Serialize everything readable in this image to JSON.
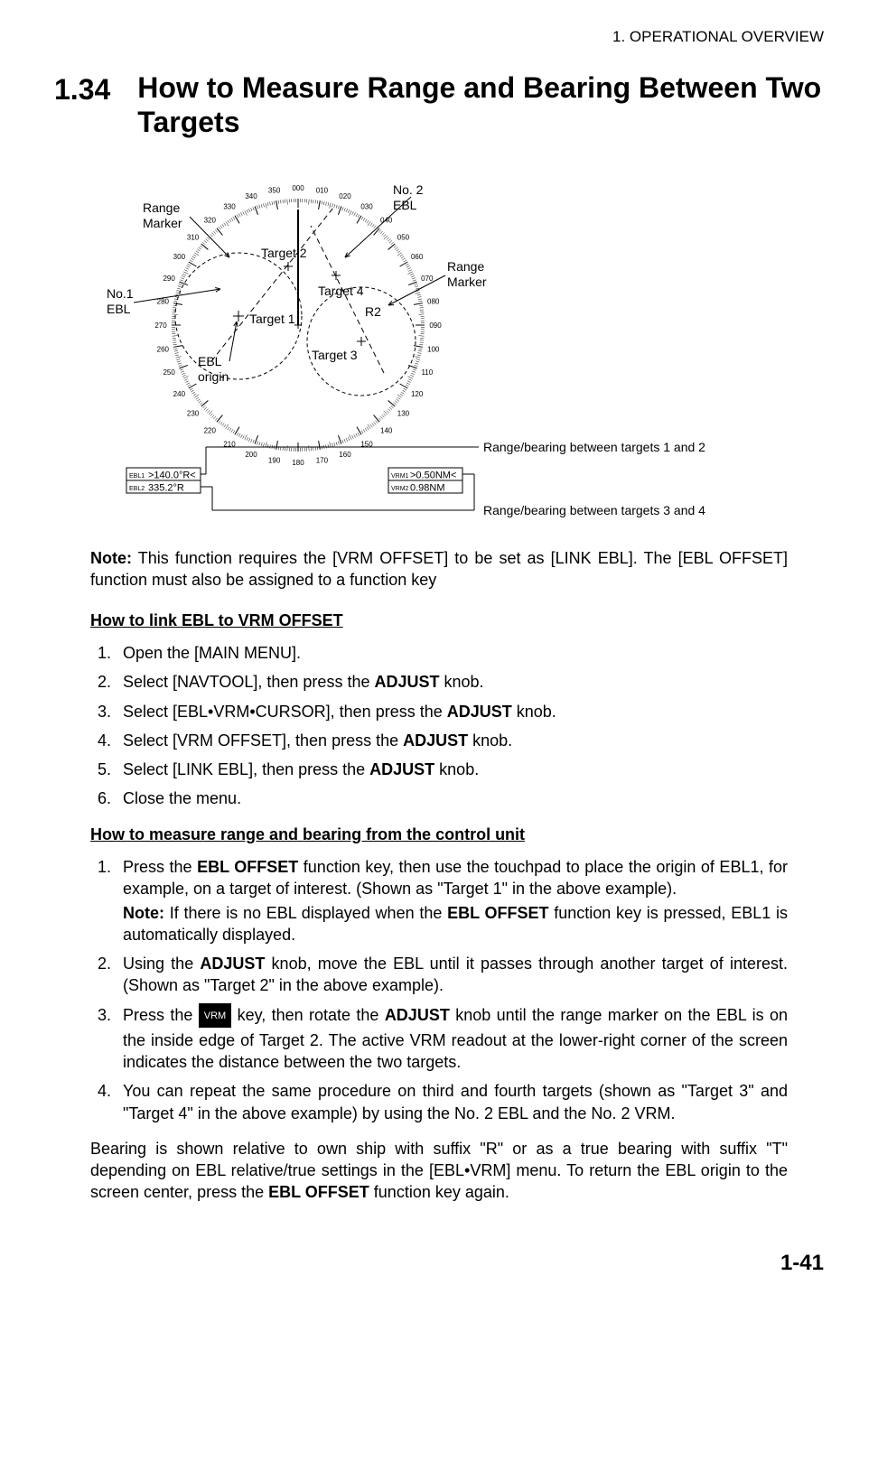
{
  "header": "1.  OPERATIONAL OVERVIEW",
  "section": {
    "number": "1.34",
    "title": "How to Measure Range and Bearing Between Two Targets"
  },
  "figure": {
    "ticks": [
      "000",
      "010",
      "020",
      "030",
      "040",
      "050",
      "060",
      "070",
      "080",
      "090",
      "100",
      "110",
      "120",
      "130",
      "140",
      "150",
      "160",
      "170",
      "180",
      "190",
      "200",
      "210",
      "220",
      "230",
      "240",
      "250",
      "260",
      "270",
      "280",
      "290",
      "300",
      "310",
      "320",
      "330",
      "340",
      "350"
    ],
    "labels": {
      "rangeMarkerLeft": "Range Marker",
      "no2ebl": "No. 2 EBL",
      "rangeMarkerRight": "Range Marker",
      "no1ebl": "No.1 EBL",
      "target1": "Target 1",
      "target2": "Target 2",
      "target3": "Target 3",
      "target4": "Target 4",
      "r2": "R2",
      "eblOrigin": "EBL origin",
      "caption12": "Range/bearing between targets 1 and 2",
      "caption34": "Range/bearing between targets 3 and 4"
    },
    "readouts": {
      "ebl1Label": "EBL1",
      "ebl1Value": ">140.0°R<",
      "ebl2Label": "EBL2",
      "ebl2Value": "335.2°R",
      "vrm1Label": "VRM1",
      "vrm1Value": ">0.50NM<",
      "vrm2Label": "VRM2",
      "vrm2Value": "0.98NM"
    }
  },
  "noteLabel": "Note:",
  "noteText": " This function requires the [VRM OFFSET] to be set as [LINK EBL]. The [EBL OFFSET] function must also be assigned to a function key",
  "subhead1": "How to link EBL to VRM OFFSET",
  "steps1": [
    {
      "pre": "Open the [MAIN MENU]."
    },
    {
      "pre": "Select [NAVTOOL], then press the ",
      "bold1": "ADJUST",
      "post1": " knob."
    },
    {
      "pre": "Select [EBL•VRM•CURSOR], then press the ",
      "bold1": "ADJUST",
      "post1": " knob."
    },
    {
      "pre": "Select [VRM OFFSET], then press the ",
      "bold1": "ADJUST",
      "post1": " knob."
    },
    {
      "pre": "Select [LINK EBL], then press the ",
      "bold1": "ADJUST",
      "post1": " knob."
    },
    {
      "pre": "Close the menu."
    }
  ],
  "subhead2": "How to measure range and bearing from the control unit",
  "steps2": [
    {
      "pre": "Press the ",
      "bold1": "EBL OFFSET",
      "post1": " function key, then use the touchpad to place the origin of EBL1, for example, on a target of interest. (Shown as \"Target 1\" in the above example).",
      "subNoteLabel": "Note:",
      "subNote": " If there is no EBL displayed when the ",
      "subBold": "EBL OFFSET",
      "subPost": " function key is pressed, EBL1 is automatically displayed."
    },
    {
      "pre": "Using the ",
      "bold1": "ADJUST",
      "post1": " knob, move the EBL until it passes through another target of interest. (Shown as \"Target 2\" in the above example)."
    },
    {
      "pre": "Press the ",
      "keyLabel": "VRM",
      "mid": " key, then rotate the ",
      "bold1": "ADJUST",
      "post1": " knob until the range marker on the EBL is on the inside edge of Target 2. The active VRM readout at the lower-right corner of the screen indicates the distance between the two targets."
    },
    {
      "pre": "You can repeat the same procedure on third and fourth targets (shown as \"Target 3\" and \"Target 4\" in the above example) by using the No. 2 EBL and the No. 2 VRM."
    }
  ],
  "closingPara": {
    "pre": "Bearing is shown relative to own ship with suffix \"R\" or as a true bearing with suffix \"T\" depending on EBL relative/true settings in the [EBL•VRM] menu. To return the EBL origin to the screen center, press the ",
    "bold": "EBL OFFSET",
    "post": " function key again."
  },
  "footer": "1-41"
}
